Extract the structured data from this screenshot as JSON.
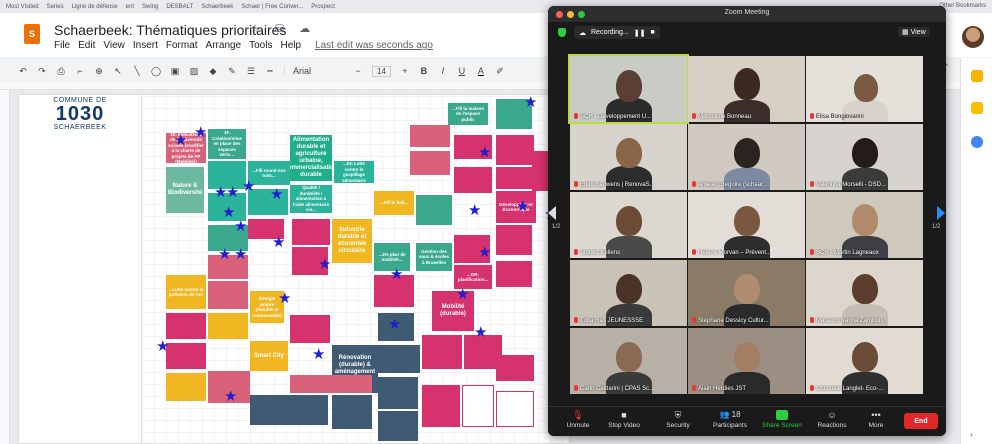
{
  "browser": {
    "bookmarks": [
      "Most Visited",
      "Series",
      "Ligne de défense",
      "ent",
      "Swing",
      "DESBALT",
      "Schaerbeek",
      "Schaer | Free Conver...",
      "Prospect"
    ],
    "bookmarks_right": "Other Bookmarks"
  },
  "docs": {
    "app_icon_label": "S",
    "title": "Schaerbeek: Thématiques prioritaires",
    "title_icons": "☆ ⛁ ☁",
    "menu": [
      "File",
      "Edit",
      "View",
      "Insert",
      "Format",
      "Arrange",
      "Tools",
      "Help"
    ],
    "edit_status": "Last edit was seconds ago",
    "toolbar": {
      "font": "Arial",
      "font_size": "14",
      "bold": "B",
      "italic": "I",
      "underline": "U",
      "text_color": "A"
    }
  },
  "slide": {
    "logo_line1": "COMMUNE DE",
    "logo_line2": "1030",
    "logo_line3": "SCHAERBEEK",
    "stickies": [
      {
        "text": "1E. Indicateurs de biodiversité suivies (modifier à la charte de projets de PP (Mobilité))",
        "color": "#d9627a"
      },
      {
        "text": "1F. Création/mise en place des espaces verts…",
        "color": "#3aa88c"
      },
      {
        "text": "Nature & Biodiversité",
        "color": "#6db8a0"
      },
      {
        "text": "Alimentation durable et agriculture urbaine, commercialisation durable",
        "color": "#1fae89"
      },
      {
        "text": "...Fill round nos toits...",
        "color": "#2bb39b"
      },
      {
        "text": "...En Lutte contre le gaspillage alimentaire",
        "color": "#2bb39b"
      },
      {
        "text": "Qualité / durabilité / alimentation à l'aide alimentaire via...",
        "color": "#2bb39b"
      },
      {
        "text": "...Fill le bail...",
        "color": "#f1b722"
      },
      {
        "text": "Industrie durable et économie circulaire",
        "color": "#f1b722"
      },
      {
        "text": "...Lutte contre la pollution de l'air",
        "color": "#f1b722"
      },
      {
        "text": "Énergie propre (durable et renouvelable)",
        "color": "#f1b722"
      },
      {
        "text": "Smart City",
        "color": "#f1b722"
      },
      {
        "text": "Rénovation (durable) & aménagement du territoire",
        "color": "#3f5b73"
      },
      {
        "text": "Mobilité (durable)",
        "color": "#d6326e"
      },
      {
        "text": "Développement Économique",
        "color": "#d6326e"
      },
      {
        "text": "...4% plan de mobilité...",
        "color": "#3aa88c"
      },
      {
        "text": "Gestion des eaux & écoles à Bruxelles",
        "color": "#3aa88c"
      },
      {
        "text": "...GR-planification...",
        "color": "#d6326e"
      },
      {
        "text": "...Fill la maison de l'espace public",
        "color": "#3aa88c"
      }
    ]
  },
  "zoom": {
    "window_title": "Zoom Meeting",
    "recording_label": "Recording...",
    "view_label": "View",
    "page_left": "1/2",
    "page_right": "1/2",
    "participants": [
      {
        "name": "SCH - Développement U..."
      },
      {
        "name": "Marcelline Bonneau"
      },
      {
        "name": "Elisa Bongiovanni"
      },
      {
        "name": "Edith Bauwens | RenovaS..."
      },
      {
        "name": "Amélie Gregoire (schaar..."
      },
      {
        "name": "Valentina Morselli - DSD..."
      },
      {
        "name": "Sigried Kellens"
      },
      {
        "name": "Hélène Morvan – Prévent..."
      },
      {
        "name": "SCH - Martin Lagneaux"
      },
      {
        "name": "Tuba Ras JEUNESSSE"
      },
      {
        "name": "Stéphane Dessicy Cultur..."
      },
      {
        "name": "Maria Giovanna Zamburl..."
      },
      {
        "name": "Carlo Caldarini | CPAS Sc..."
      },
      {
        "name": "Alain Herdies  JST"
      },
      {
        "name": "Christelle Langlet- Eco-..."
      }
    ],
    "controls": {
      "unmute": "Unmute",
      "stop_video": "Stop Video",
      "security": "Security",
      "participants": "Participants",
      "participants_count": "18",
      "share_screen": "Share Screen",
      "reactions": "Reactions",
      "more": "More",
      "end": "End"
    }
  }
}
